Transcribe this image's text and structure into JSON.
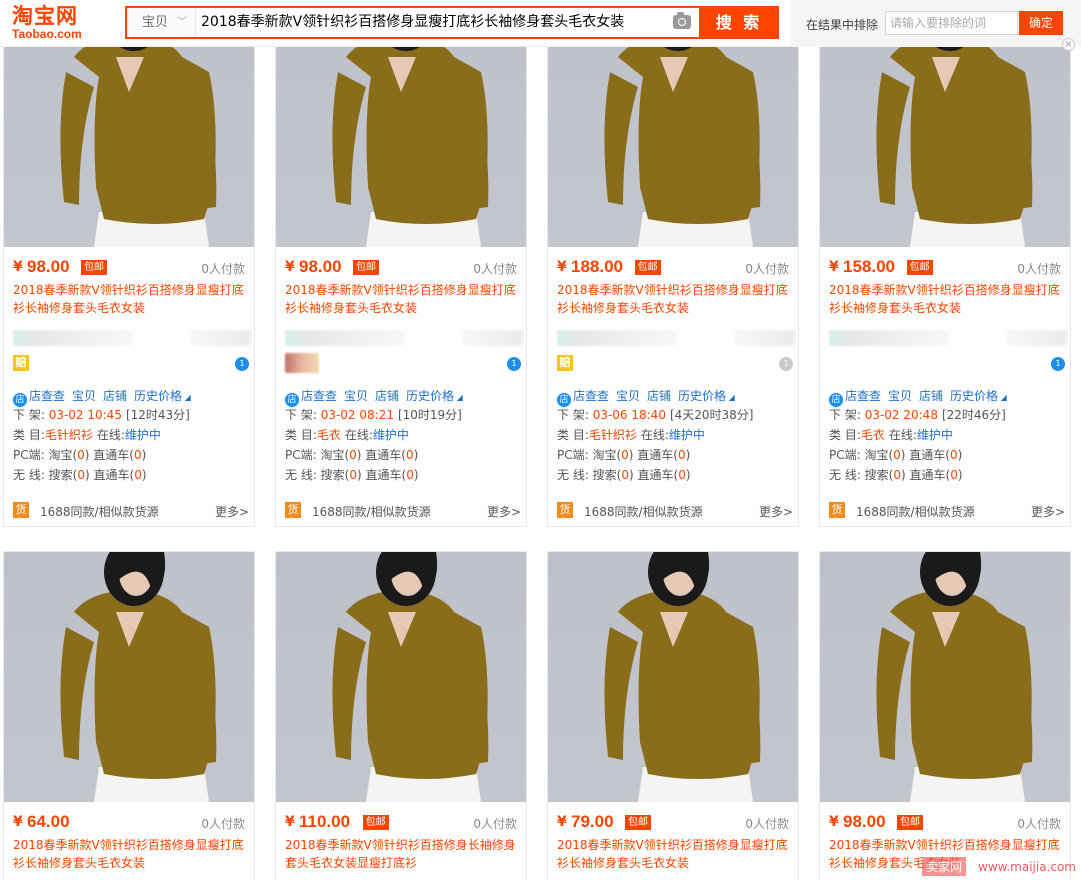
{
  "header": {
    "logo_cn": "淘宝网",
    "logo_en": "Taobao.com",
    "search_type": "宝贝",
    "search_query": "2018春季新款V领针织衫百搭修身显瘦打底衫长袖修身套头毛衣女装",
    "search_button": "搜 索",
    "exclude_label": "在结果中排除",
    "exclude_placeholder": "请输入要排除的词",
    "exclude_button": "确定"
  },
  "labels": {
    "currency": "¥",
    "free_shipping": "包邮",
    "tool_store_icon": "店",
    "tool_check": "店查查",
    "tool_item": "宝贝",
    "tool_shop": "店铺",
    "tool_history": "历史价格",
    "delist_prefix": "下 架:",
    "category_prefix": "类 目:",
    "online_prefix": "在线:",
    "pc_prefix": "PC端: 淘宝(",
    "wireless_prefix": "无 线: 搜索(",
    "through_train": ") 直通车(",
    "close_paren": ")",
    "source_text": "1688同款/相似款货源",
    "more": "更多>",
    "pei_icon": "赔",
    "huo_icon": "货",
    "ww_icon": "1"
  },
  "products": [
    {
      "price": "98.00",
      "free_shipping": true,
      "sales": "0人付款",
      "title_line1": "2018春季新款V领针织衫百搭修身显瘦打底",
      "title_line2": "衫长袖修身套头毛衣女装",
      "badge": "pei",
      "ww_online": true,
      "delist_time": "03-02 10:45",
      "delist_remaining": "[12时43分]",
      "category": "毛针织衫",
      "online_status": "维护中",
      "pc_taobao": "0",
      "pc_through": "0",
      "wl_search": "0",
      "wl_through": "0"
    },
    {
      "price": "98.00",
      "free_shipping": true,
      "sales": "0人付款",
      "title_line1": "2018春季新款V领针织衫百搭修身显瘦打底",
      "title_line2": "衫长袖修身套头毛衣女装",
      "badge": "avatar",
      "ww_online": true,
      "delist_time": "03-02 08:21",
      "delist_remaining": "[10时19分]",
      "category": "毛衣",
      "online_status": "维护中",
      "pc_taobao": "0",
      "pc_through": "0",
      "wl_search": "0",
      "wl_through": "0"
    },
    {
      "price": "188.00",
      "free_shipping": true,
      "sales": "0人付款",
      "title_line1": "2018春季新款V领针织衫百搭修身显瘦打底",
      "title_line2": "衫长袖修身套头毛衣女装",
      "badge": "pei",
      "ww_online": false,
      "delist_time": "03-06 18:40",
      "delist_remaining": "[4天20时38分]",
      "category": "毛针织衫",
      "online_status": "维护中",
      "pc_taobao": "0",
      "pc_through": "0",
      "wl_search": "0",
      "wl_through": "0"
    },
    {
      "price": "158.00",
      "free_shipping": true,
      "sales": "0人付款",
      "title_line1": "2018春季新款V领针织衫百搭修身显瘦打底",
      "title_line2": "衫长袖修身套头毛衣女装",
      "badge": "none",
      "ww_online": true,
      "delist_time": "03-02 20:48",
      "delist_remaining": "[22时46分]",
      "category": "毛衣",
      "online_status": "维护中",
      "pc_taobao": "0",
      "pc_through": "0",
      "wl_search": "0",
      "wl_through": "0"
    },
    {
      "price": "64.00",
      "free_shipping": false,
      "sales": "0人付款",
      "title_line1": "2018春季新款V领针织衫百搭修身显瘦打底",
      "title_line2": "衫长袖修身套头毛衣女装"
    },
    {
      "price": "110.00",
      "free_shipping": true,
      "sales": "0人付款",
      "title_line1": "2018春季新款V领针织衫百搭修身长袖修身",
      "title_line2": "套头毛衣女装显瘦打底衫"
    },
    {
      "price": "79.00",
      "free_shipping": true,
      "sales": "0人付款",
      "title_line1": "2018春季新款V领针织衫百搭修身显瘦打底",
      "title_line2": "衫长袖修身套头毛衣女装"
    },
    {
      "price": "98.00",
      "free_shipping": true,
      "sales": "0人付款",
      "title_line1": "2018春季新款V领针织衫百搭修身显瘦打底",
      "title_line2": "衫长袖修身套头毛衣女装"
    }
  ],
  "watermark": {
    "box_text": "卖家网",
    "url": "www.maijia.com"
  },
  "colors": {
    "accent": "#ff4400",
    "link_blue": "#1f6fcf",
    "sweater": "#8a6d1a",
    "pants": "#f4f4f4",
    "hair": "#1a1a1a",
    "skin": "#e6c9b5"
  }
}
